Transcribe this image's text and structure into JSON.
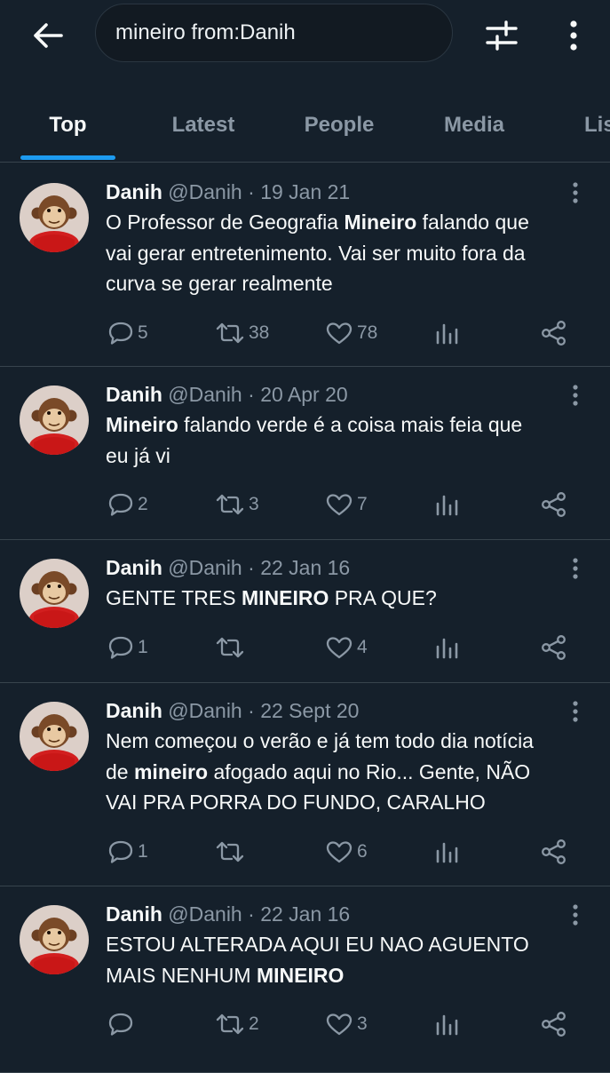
{
  "search": {
    "query": "mineiro from:Danih"
  },
  "tabs": [
    {
      "label": "Top",
      "active": true
    },
    {
      "label": "Latest",
      "active": false
    },
    {
      "label": "People",
      "active": false
    },
    {
      "label": "Media",
      "active": false
    },
    {
      "label": "Lists",
      "active": false
    }
  ],
  "icons": {
    "back": "arrow-left-icon",
    "filter": "sliders-icon",
    "more": "vertical-ellipsis-icon",
    "reply": "speech-bubble-icon",
    "retweet": "retweet-icon",
    "like": "heart-icon",
    "views": "bar-chart-icon",
    "share": "share-icon"
  },
  "colors": {
    "background": "#15202b",
    "accent": "#1d9bf0",
    "muted": "#8b98a5",
    "divider": "#38444d"
  },
  "tweets": [
    {
      "name": "Danih",
      "handle": "@Danih",
      "dot": "·",
      "date": "19 Jan 21",
      "lines": [
        {
          "pre": "O Professor de Geografia ",
          "hl": "Mineiro",
          "post": " falando que"
        },
        {
          "pre": "vai gerar entretenimento. Vai ser muito fora da",
          "hl": "",
          "post": ""
        },
        {
          "pre": "curva se gerar realmente",
          "hl": "",
          "post": ""
        }
      ],
      "replies": "5",
      "retweets": "38",
      "likes": "78"
    },
    {
      "name": "Danih",
      "handle": "@Danih",
      "dot": "·",
      "date": "20 Apr 20",
      "lines": [
        {
          "pre": "",
          "hl": "Mineiro",
          "post": " falando verde é a coisa mais feia que"
        },
        {
          "pre": "eu já vi",
          "hl": "",
          "post": ""
        }
      ],
      "replies": "2",
      "retweets": "3",
      "likes": "7"
    },
    {
      "name": "Danih",
      "handle": "@Danih",
      "dot": "·",
      "date": "22 Jan 16",
      "lines": [
        {
          "pre": "GENTE TRES ",
          "hl": "MINEIRO",
          "post": " PRA QUE?"
        }
      ],
      "replies": "1",
      "retweets": "",
      "likes": "4"
    },
    {
      "name": "Danih",
      "handle": "@Danih",
      "dot": "·",
      "date": "22 Sept 20",
      "lines": [
        {
          "pre": "Nem começou o verão e já tem todo dia notícia",
          "hl": "",
          "post": ""
        },
        {
          "pre": "de ",
          "hl": "mineiro",
          "post": " afogado aqui no Rio... Gente, NÃO"
        },
        {
          "pre": "VAI PRA PORRA DO FUNDO, CARALHO",
          "hl": "",
          "post": ""
        }
      ],
      "replies": "1",
      "retweets": "",
      "likes": "6"
    },
    {
      "name": "Danih",
      "handle": "@Danih",
      "dot": "·",
      "date": "22 Jan 16",
      "lines": [
        {
          "pre": "ESTOU ALTERADA AQUI EU NAO AGUENTO",
          "hl": "",
          "post": ""
        },
        {
          "pre": "MAIS NENHUM ",
          "hl": "MINEIRO",
          "post": ""
        }
      ],
      "replies": "",
      "retweets": "2",
      "likes": "3"
    }
  ]
}
